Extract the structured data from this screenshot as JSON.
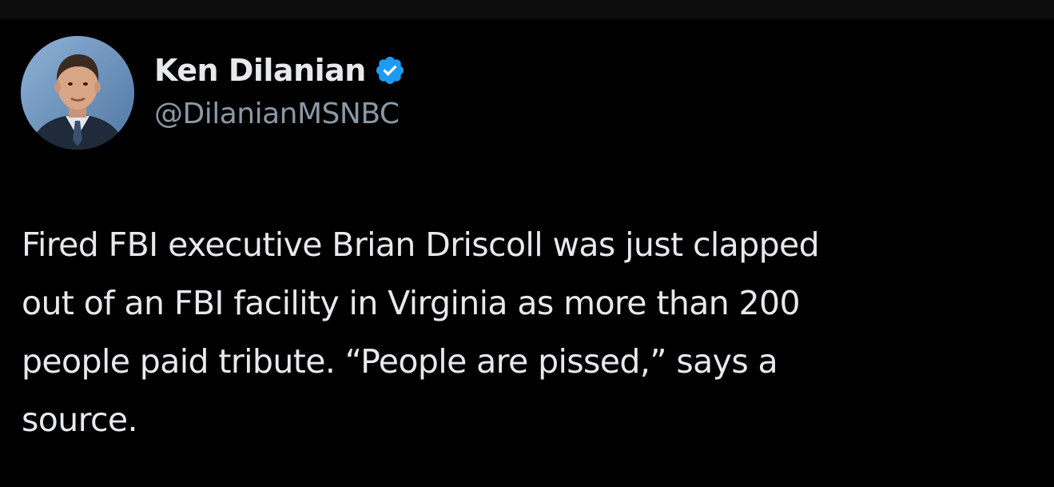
{
  "author": {
    "display_name": "Ken Dilanian",
    "handle": "@DilanianMSNBC",
    "verified": true,
    "avatar_icon": "profile-photo"
  },
  "tweet": {
    "text": "Fired FBI executive Brian Driscoll was just clapped\nout of an FBI facility in Virginia as more than 200\npeople paid tribute. “People are pissed,” says a\nsource."
  },
  "colors": {
    "background": "#000000",
    "text_primary": "#e7e9ea",
    "text_secondary": "#8b98a5",
    "verified_badge": "#1d9bf0"
  }
}
